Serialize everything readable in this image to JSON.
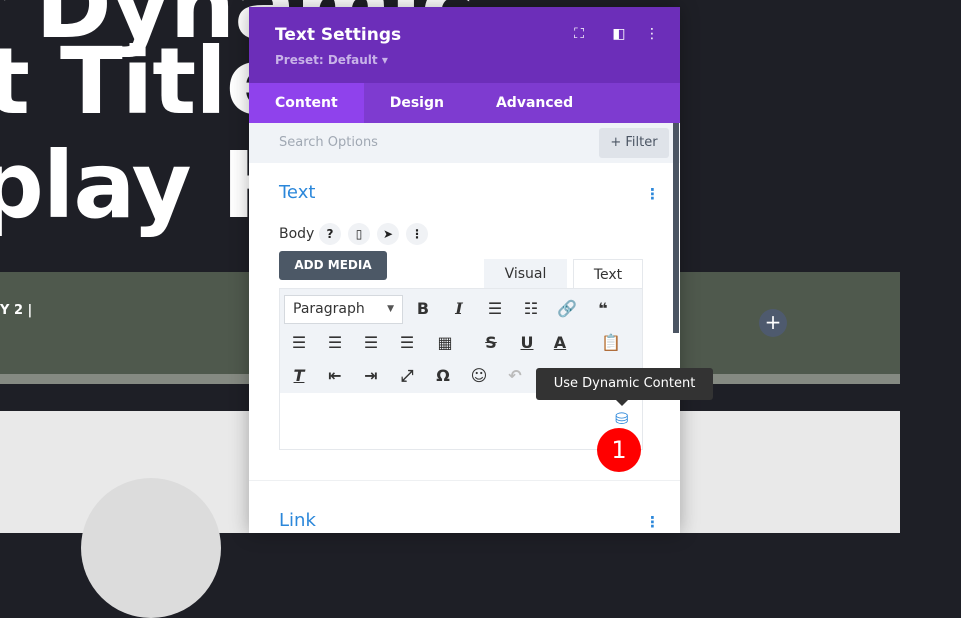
{
  "background": {
    "hero_lines": [
      "r Dynamic",
      "t Title",
      "play H"
    ],
    "band_text": "Y 2 |",
    "add_button": "+"
  },
  "panel": {
    "title": "Text Settings",
    "preset": "Preset: Default ▾",
    "icons": [
      "fullscreen-icon",
      "split-view-icon",
      "more-icon"
    ],
    "tabs": [
      "Content",
      "Design",
      "Advanced"
    ],
    "search_placeholder": "Search Options",
    "filter_label": "+ Filter",
    "section_text": "Text",
    "section_link": "Link",
    "body_label": "Body",
    "add_media": "ADD MEDIA",
    "editor_tabs": [
      "Visual",
      "Text"
    ],
    "format_select": "Paragraph"
  },
  "tooltip": "Use Dynamic Content",
  "step_badge": "1"
}
